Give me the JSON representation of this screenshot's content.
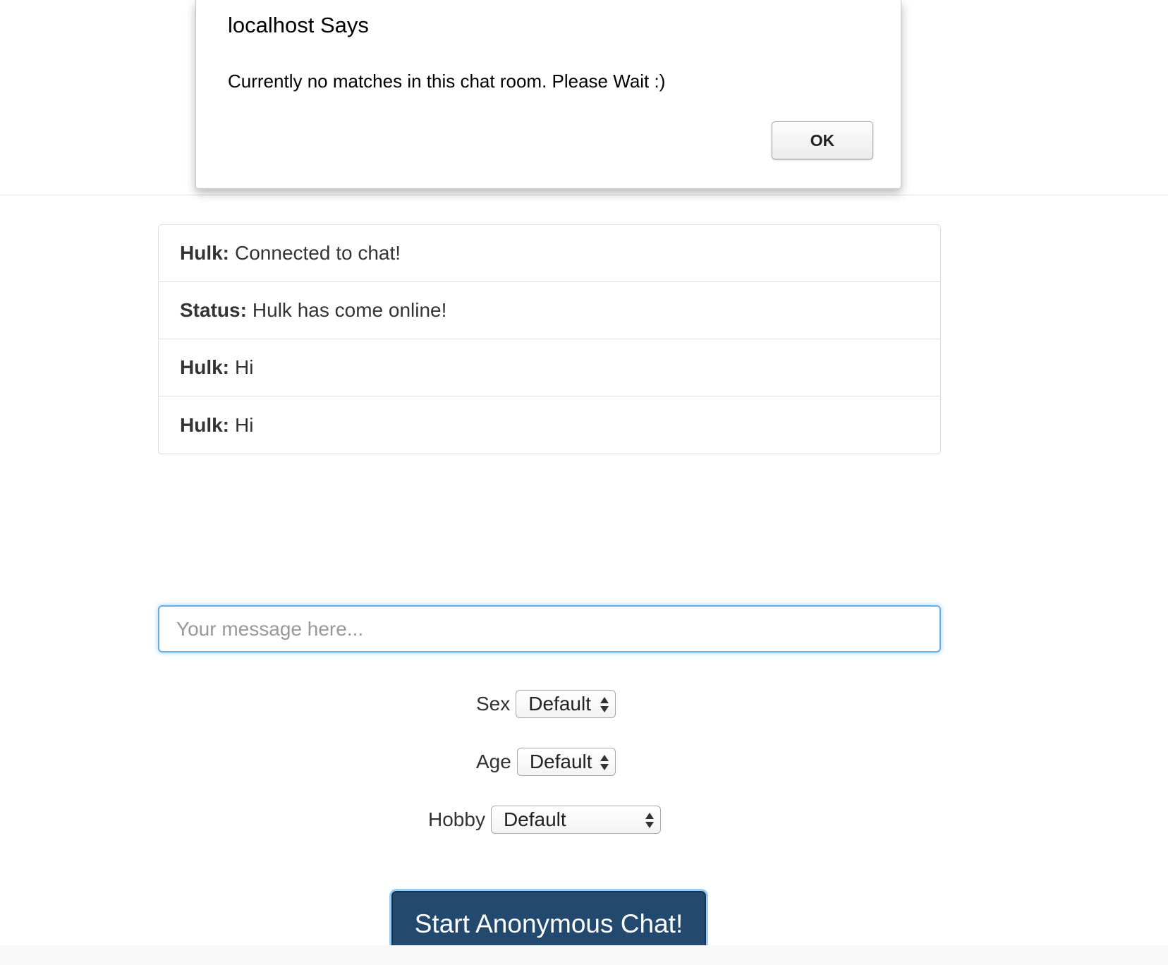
{
  "dialog": {
    "title": "localhost Says",
    "message": "Currently no matches in this chat room. Please Wait :)",
    "ok_label": "OK"
  },
  "chat": {
    "messages": [
      {
        "sender": "Hulk:",
        "text": "Connected to chat!"
      },
      {
        "sender": "Status:",
        "text": "Hulk has come online!"
      },
      {
        "sender": "Hulk:",
        "text": "Hi"
      },
      {
        "sender": "Hulk:",
        "text": "Hi"
      }
    ]
  },
  "composer": {
    "placeholder": "Your message here...",
    "value": ""
  },
  "filters": {
    "sex": {
      "label": "Sex",
      "selected": "Default"
    },
    "age": {
      "label": "Age",
      "selected": "Default"
    },
    "hobby": {
      "label": "Hobby",
      "selected": "Default"
    }
  },
  "start_button": {
    "label": "Start Anonymous Chat!"
  },
  "colors": {
    "primary_button": "#23496e",
    "focus_ring": "#66afe9",
    "border": "#dddddd"
  },
  "icons": {
    "select_arrows": "updown-arrows-icon"
  }
}
